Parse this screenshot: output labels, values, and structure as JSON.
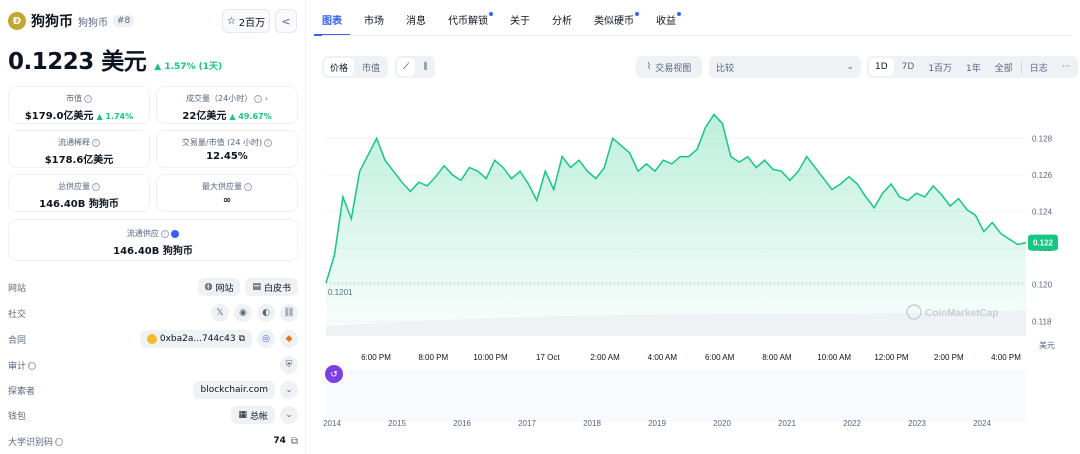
{
  "coin": {
    "logo_glyph": "Ð",
    "name": "狗狗币",
    "symbol": "狗狗币",
    "rank": "#8",
    "watch_label": "2百万",
    "price": "0.1223 美元",
    "change": "▲ 1.57% (1天)"
  },
  "stats": {
    "market_cap": {
      "label": "市值",
      "value": "$179.0亿美元",
      "pct": "▲ 1.74%"
    },
    "volume": {
      "label": "成交量（24小时）",
      "value": "22亿美元",
      "pct": "▲ 49.67%"
    },
    "fdv": {
      "label": "流通稀释",
      "value": "$178.6亿美元"
    },
    "vol_mcap": {
      "label": "交易量/市值 (24 小时)",
      "value": "12.45%"
    },
    "total_supply": {
      "label": "总供应量",
      "value": "146.40B 狗狗币"
    },
    "max_supply": {
      "label": "最大供应量",
      "value": "∞"
    },
    "circ_supply": {
      "label": "流通供应",
      "value": "146.40B 狗狗币"
    }
  },
  "links": {
    "website": {
      "label": "网站",
      "site_btn": "网站",
      "wp_btn": "白皮书"
    },
    "social": {
      "label": "社交"
    },
    "contract": {
      "label": "合同",
      "address": "0xba2a...744c43"
    },
    "audit": {
      "label": "审计"
    },
    "explorer": {
      "label": "探索者",
      "value": "blockchair.com"
    },
    "wallet": {
      "label": "钱包",
      "value": "总帐"
    },
    "ucid": {
      "label": "大学识别码",
      "value": "74"
    }
  },
  "tabs": [
    {
      "label": "图表",
      "dot": false
    },
    {
      "label": "市场",
      "dot": false
    },
    {
      "label": "消息",
      "dot": false
    },
    {
      "label": "代币解锁",
      "dot": true
    },
    {
      "label": "关于",
      "dot": false
    },
    {
      "label": "分析",
      "dot": false
    },
    {
      "label": "类似硬币",
      "dot": true
    },
    {
      "label": "收益",
      "dot": true
    }
  ],
  "toolbar": {
    "price_opt": "价格",
    "mcap_opt": "市值",
    "tradingview": "交易视图",
    "compare": "比较",
    "ranges": [
      "1D",
      "7D",
      "1百万",
      "1年",
      "全部",
      "日志",
      "···"
    ],
    "selected_range": "1D"
  },
  "chart_data": {
    "type": "area",
    "x_ticks": [
      "6:00 PM",
      "8:00 PM",
      "10:00 PM",
      "17 Oct",
      "2:00 AM",
      "4:00 AM",
      "6:00 AM",
      "8:00 AM",
      "10:00 AM",
      "12:00 PM",
      "2:00 PM",
      "4:00 PM"
    ],
    "y_ticks": [
      "0.128",
      "0.126",
      "0.124",
      "0.122",
      "0.120",
      "0.118"
    ],
    "ylim": [
      0.1172,
      0.1302
    ],
    "unit_label": "美元",
    "current_label": "0.122",
    "low_label": "0.1201",
    "reference_line": 0.1201,
    "watermark": "CoinMarketCap",
    "color": "#16c784",
    "series": [
      {
        "values": [
          0.1201,
          0.1216,
          0.1248,
          0.1236,
          0.1262,
          0.1271,
          0.128,
          0.1268,
          0.1262,
          0.1256,
          0.1251,
          0.1256,
          0.1254,
          0.1259,
          0.1265,
          0.126,
          0.1257,
          0.1264,
          0.1262,
          0.1258,
          0.1268,
          0.1264,
          0.1258,
          0.1262,
          0.1255,
          0.1246,
          0.1262,
          0.1252,
          0.127,
          0.1264,
          0.1268,
          0.1262,
          0.1258,
          0.1264,
          0.128,
          0.1276,
          0.1272,
          0.1262,
          0.1266,
          0.1262,
          0.1268,
          0.1266,
          0.127,
          0.127,
          0.1274,
          0.1286,
          0.1293,
          0.1288,
          0.127,
          0.1267,
          0.127,
          0.1264,
          0.1268,
          0.1263,
          0.1262,
          0.1257,
          0.1262,
          0.127,
          0.1264,
          0.1258,
          0.1252,
          0.1255,
          0.1259,
          0.1255,
          0.1248,
          0.1242,
          0.125,
          0.1255,
          0.1248,
          0.1246,
          0.125,
          0.1248,
          0.1254,
          0.1249,
          0.1243,
          0.1247,
          0.1241,
          0.1238,
          0.1229,
          0.1234,
          0.1228,
          0.1225,
          0.1222,
          0.1223
        ]
      }
    ],
    "timeline": {
      "years": [
        "2014",
        "2015",
        "2016",
        "2017",
        "2018",
        "2019",
        "2020",
        "2021",
        "2022",
        "2023",
        "2024"
      ]
    }
  }
}
